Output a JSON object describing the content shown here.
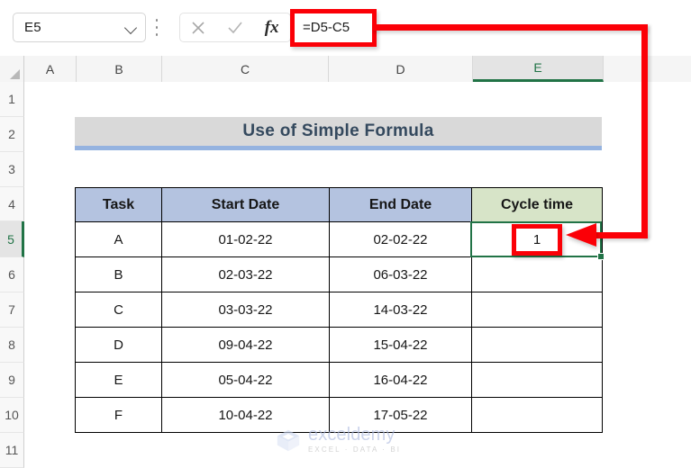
{
  "formula_bar": {
    "name_box_value": "E5",
    "name_box_placeholder": "Name Box",
    "dropdown_icon": "chevron-down-icon",
    "kebab_icon": "more-options-icon",
    "cancel_icon": "cancel-x-icon",
    "enter_icon": "enter-check-icon",
    "function_icon": "fx-insert-function-icon",
    "formula_value": "=D5-C5",
    "formula_placeholder": "Formula Bar"
  },
  "grid": {
    "corner_icon": "select-all-corner-icon",
    "columns": [
      "A",
      "B",
      "C",
      "D",
      "E"
    ],
    "selected_column": "E",
    "rows": [
      "1",
      "2",
      "3",
      "4",
      "5",
      "6",
      "7",
      "8",
      "9",
      "10",
      "11"
    ],
    "selected_row": "5"
  },
  "sheet": {
    "title": "Use of Simple Formula",
    "table": {
      "headers": [
        "Task",
        "Start Date",
        "End Date",
        "Cycle time"
      ],
      "rows": [
        {
          "task": "A",
          "start": "01-02-22",
          "end": "02-02-22",
          "cycle": "1"
        },
        {
          "task": "B",
          "start": "02-03-22",
          "end": "06-03-22",
          "cycle": ""
        },
        {
          "task": "C",
          "start": "03-03-22",
          "end": "14-03-22",
          "cycle": ""
        },
        {
          "task": "D",
          "start": "09-04-22",
          "end": "15-04-22",
          "cycle": ""
        },
        {
          "task": "E",
          "start": "05-04-22",
          "end": "16-04-22",
          "cycle": ""
        },
        {
          "task": "F",
          "start": "10-04-22",
          "end": "17-05-22",
          "cycle": ""
        }
      ]
    }
  },
  "annotations": {
    "formula_highlight": "red-box-around-formula",
    "cell_highlight": "red-box-around-result",
    "arrow": "red-arrow-formula-to-cell"
  },
  "watermark": {
    "logo_icon": "exceldemy-cube-logo-icon",
    "brand": "exceldemy",
    "tagline": "EXCEL · DATA · BI"
  },
  "colors": {
    "selection_green": "#217346",
    "annotation_red": "#fb0007",
    "header_blue": "#b4c3e0",
    "cycle_green": "#d7e4c8",
    "title_gray": "#d9d9d9",
    "title_underline_blue": "#95b3e0"
  }
}
